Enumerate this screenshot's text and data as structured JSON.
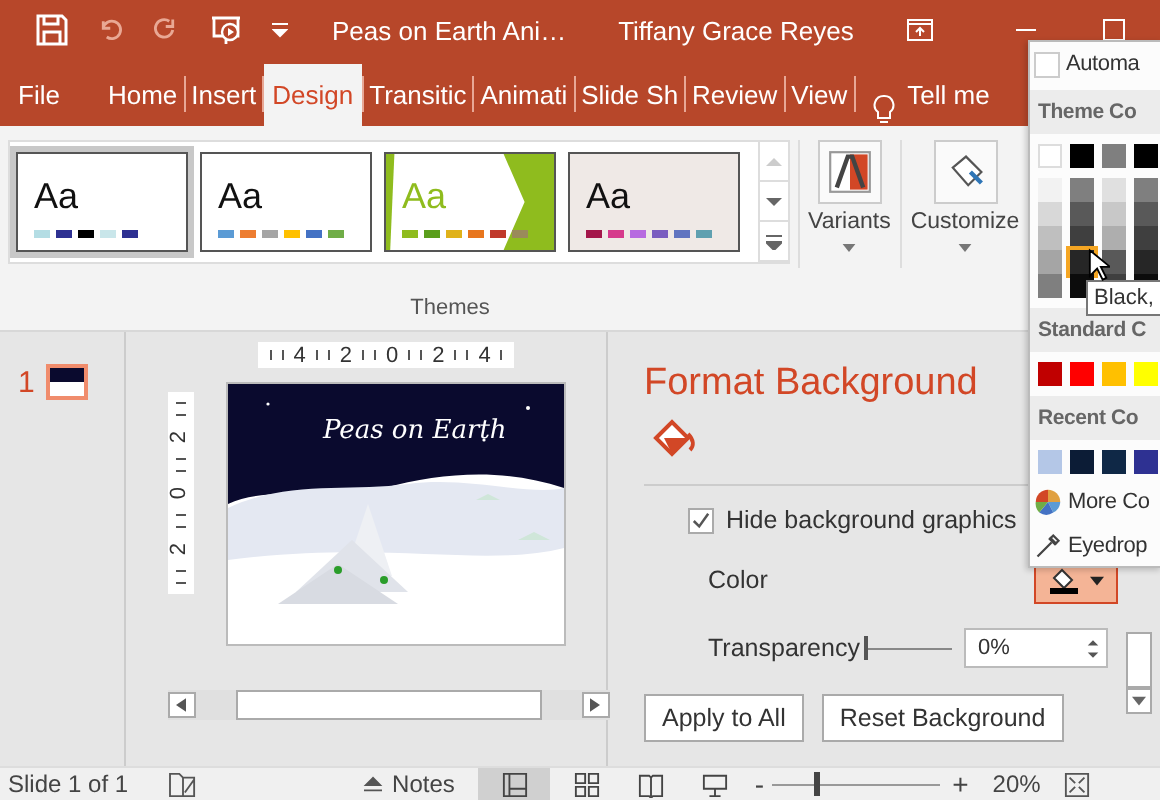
{
  "title_bar": {
    "file_name": "Peas on Earth Ani…",
    "user": "Tiffany Grace Reyes"
  },
  "tabs": [
    {
      "label": "File",
      "selected": false
    },
    {
      "label": "Home",
      "selected": false
    },
    {
      "label": "Insert",
      "selected": false
    },
    {
      "label": "Design",
      "selected": true
    },
    {
      "label": "Transitic",
      "selected": false
    },
    {
      "label": "Animati",
      "selected": false
    },
    {
      "label": "Slide Sh",
      "selected": false
    },
    {
      "label": "Review",
      "selected": false
    },
    {
      "label": "View",
      "selected": false
    }
  ],
  "tell_me": "Tell me",
  "themes": {
    "label": "Themes",
    "items": [
      {
        "sample": "Aa",
        "selected": true,
        "swatches": [
          {
            "color": "#b4dde4"
          },
          {
            "color": "#2e3192"
          },
          {
            "color": "#000000"
          },
          {
            "color": "#c9e6ea"
          },
          {
            "color": "#2e3192"
          }
        ]
      },
      {
        "sample": "Aa",
        "selected": false,
        "swatches": [
          {
            "color": "#5b9bd5"
          },
          {
            "color": "#ed7d31"
          },
          {
            "color": "#a5a5a5"
          },
          {
            "color": "#ffc000"
          },
          {
            "color": "#4472c4"
          },
          {
            "color": "#70ad47"
          }
        ]
      },
      {
        "sample": "Aa",
        "selected": false,
        "swatches": [
          {
            "color": "#8fbc1e"
          },
          {
            "color": "#5a9e1c"
          },
          {
            "color": "#e0b21a"
          },
          {
            "color": "#e8761e"
          },
          {
            "color": "#c0392b"
          },
          {
            "color": "#9a8a5a"
          }
        ]
      },
      {
        "sample": "Aa",
        "selected": false,
        "swatches": [
          {
            "color": "#a4174b"
          },
          {
            "color": "#d63a8c"
          },
          {
            "color": "#b76ae0"
          },
          {
            "color": "#7a5cc0"
          },
          {
            "color": "#6074c0"
          },
          {
            "color": "#5fa0b0"
          }
        ]
      }
    ]
  },
  "variants": "Variants",
  "customize": "Customize",
  "slides": [
    {
      "number": "1",
      "selected": true
    }
  ],
  "ruler": {
    "horizontal": [
      "4",
      "2",
      "0",
      "2",
      "4"
    ],
    "vertical": [
      "2",
      "0",
      "2"
    ]
  },
  "slide": {
    "title": "Peas on Earth"
  },
  "pane": {
    "title": "Format Background",
    "hide_graphics": {
      "label": "Hide background graphics",
      "checked": true
    },
    "color_label": "Color",
    "transparency": {
      "label": "Transparency",
      "level": 0,
      "value": "0%"
    },
    "buttons": [
      "Apply to All",
      "Reset Background"
    ]
  },
  "color_menu": {
    "automatic": "Automa",
    "theme_header": "Theme Co",
    "theme_top": [
      {
        "color": "#ffffff",
        "selected": false
      },
      {
        "color": "#000000",
        "selected": false
      },
      {
        "color": "#7f7f7f",
        "selected": false
      },
      {
        "color": "#000000",
        "selected": false
      }
    ],
    "theme_shades": [
      [
        {
          "color": "#f2f2f2",
          "selected": false
        },
        {
          "color": "#d8d8d8",
          "selected": false
        },
        {
          "color": "#bfbfbf",
          "selected": false
        },
        {
          "color": "#a5a5a5",
          "selected": false
        },
        {
          "color": "#7f7f7f",
          "selected": false
        }
      ],
      [
        {
          "color": "#7f7f7f",
          "selected": false
        },
        {
          "color": "#595959",
          "selected": false
        },
        {
          "color": "#3f3f3f",
          "selected": false
        },
        {
          "color": "#262626",
          "selected": true
        },
        {
          "color": "#0c0c0c",
          "selected": false
        }
      ],
      [
        {
          "color": "#e0e0e0",
          "selected": false
        },
        {
          "color": "#c8c8c8",
          "selected": false
        },
        {
          "color": "#aeaeae",
          "selected": false
        },
        {
          "color": "#595959",
          "selected": false
        },
        {
          "color": "#3f3f3f",
          "selected": false
        }
      ],
      [
        {
          "color": "#7f7f7f",
          "selected": false
        },
        {
          "color": "#595959",
          "selected": false
        },
        {
          "color": "#3f3f3f",
          "selected": false
        },
        {
          "color": "#262626",
          "selected": false
        },
        {
          "color": "#0c0c0c",
          "selected": false
        }
      ]
    ],
    "standard_header": "Standard C",
    "standard": [
      {
        "color": "#c00000"
      },
      {
        "color": "#ff0000"
      },
      {
        "color": "#ffc000"
      },
      {
        "color": "#ffff00"
      }
    ],
    "recent_header": "Recent Co",
    "recent": [
      {
        "color": "#b4c7e7"
      },
      {
        "color": "#0c1c36"
      },
      {
        "color": "#0f2846"
      },
      {
        "color": "#2e3192"
      }
    ],
    "more": "More Co",
    "eyedropper": "Eyedrop",
    "tooltip": "Black,"
  },
  "status_bar": {
    "slide": "Slide 1 of 1",
    "notes": "Notes",
    "zoom": {
      "level": 0.25,
      "minus": "-",
      "plus": "+",
      "value": "20%"
    }
  }
}
